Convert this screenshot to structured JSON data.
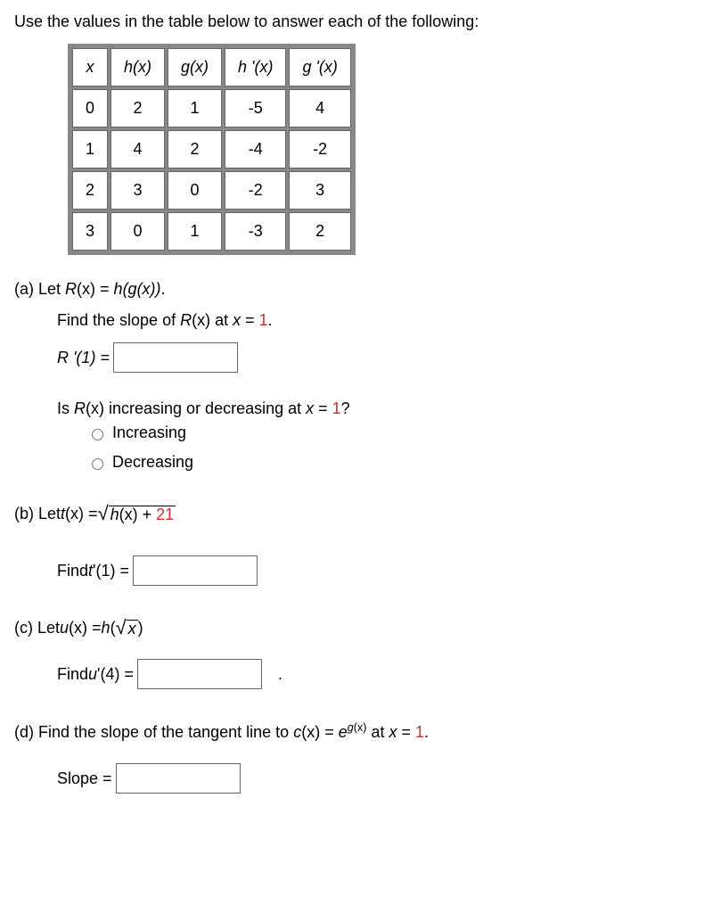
{
  "intro": "Use the values in the table below to answer each of the following:",
  "table": {
    "headers": [
      "x",
      "h(x)",
      "g(x)",
      "h '(x)",
      "g '(x)"
    ],
    "rows": [
      [
        "0",
        "2",
        "1",
        "-5",
        "4"
      ],
      [
        "1",
        "4",
        "2",
        "-4",
        "-2"
      ],
      [
        "2",
        "3",
        "0",
        "-2",
        "3"
      ],
      [
        "3",
        "0",
        "1",
        "-3",
        "2"
      ]
    ]
  },
  "partA": {
    "label": "(a) Let ",
    "def_pre": "R",
    "def_mid": "(x) = ",
    "def_post_h": "h",
    "def_post_gx": "(g(x))",
    "def_end": ".",
    "slope_text_1": "Find the slope of ",
    "slope_text_R": "R",
    "slope_text_2": "(x) at ",
    "slope_text_x": "x",
    "slope_text_3": " = ",
    "slope_val": "1",
    "slope_text_4": ".",
    "r_prime_label": "R '(1) = ",
    "inc_dec_q1": "Is ",
    "inc_dec_R": "R",
    "inc_dec_q2": "(x) increasing or decreasing at ",
    "inc_dec_x": "x",
    "inc_dec_q3": " = ",
    "inc_dec_val": "1",
    "inc_dec_q4": "?",
    "opt_inc": "Increasing",
    "opt_dec": "Decreasing"
  },
  "partB": {
    "label": "(b) Let  ",
    "t": "t",
    "paren": "(x) = ",
    "rad_content_h": "h",
    "rad_content_rest1": "(x) + ",
    "rad_num": "21",
    "find_label_1": "Find ",
    "find_label_t": "t",
    "find_label_2": " '(1) =  "
  },
  "partC": {
    "label": "(c) Let  ",
    "u": "u",
    "paren": "(x) = ",
    "h": "h",
    "open": "(",
    "rad_x": "x",
    "close": ")",
    "find_label_1": "Find ",
    "find_label_u": "u",
    "find_label_2": " '(4) =  ",
    "period": "."
  },
  "partD": {
    "label": "(d) Find the slope of the tangent line to  ",
    "c": "c",
    "paren": "(x) = ",
    "e": "e",
    "exp_g": "g",
    "exp_rest": "(x)",
    "at_text": "  at ",
    "x": "x",
    "eq": " = ",
    "val": "1",
    "end": ".",
    "slope_label": "Slope =  "
  },
  "chart_data": {
    "type": "table",
    "title": "Function values table",
    "columns": [
      "x",
      "h(x)",
      "g(x)",
      "h'(x)",
      "g'(x)"
    ],
    "rows": [
      {
        "x": 0,
        "h(x)": 2,
        "g(x)": 1,
        "h'(x)": -5,
        "g'(x)": 4
      },
      {
        "x": 1,
        "h(x)": 4,
        "g(x)": 2,
        "h'(x)": -4,
        "g'(x)": -2
      },
      {
        "x": 2,
        "h(x)": 3,
        "g(x)": 0,
        "h'(x)": -2,
        "g'(x)": 3
      },
      {
        "x": 3,
        "h(x)": 0,
        "g(x)": 1,
        "h'(x)": -3,
        "g'(x)": 2
      }
    ]
  }
}
